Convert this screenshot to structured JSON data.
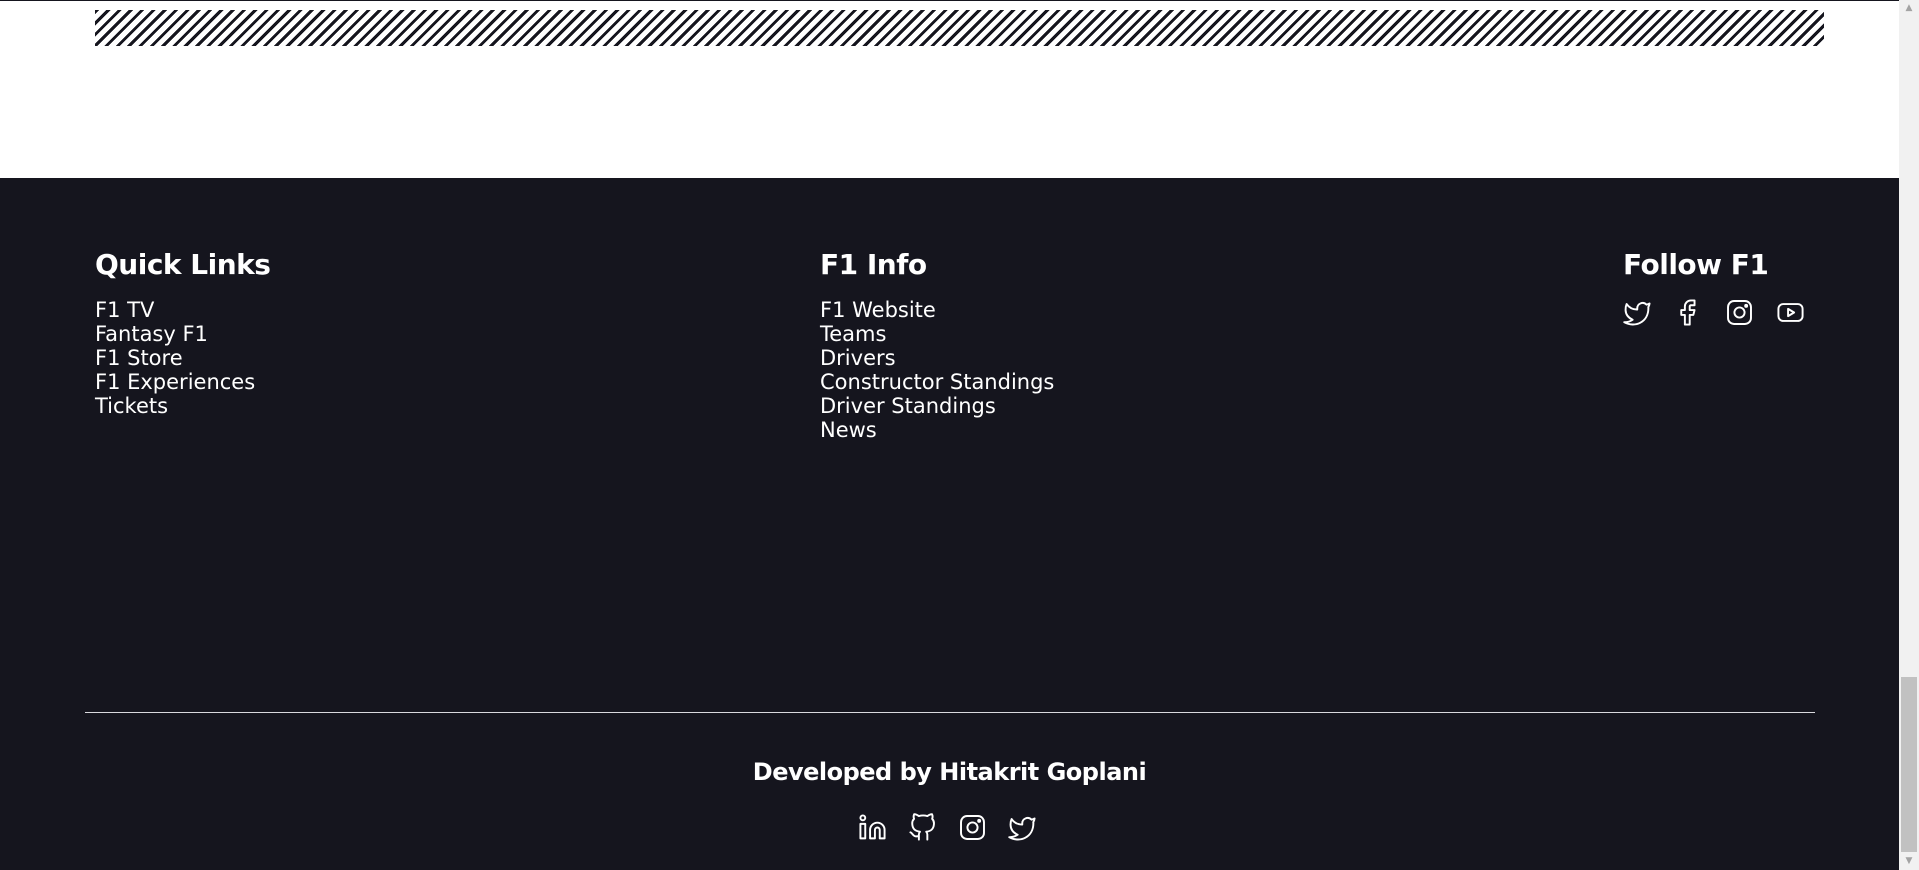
{
  "quick_links": {
    "heading": "Quick Links",
    "items": [
      "F1 TV",
      "Fantasy F1",
      "F1 Store",
      "F1 Experiences",
      "Tickets"
    ]
  },
  "f1_info": {
    "heading": "F1 Info",
    "items": [
      "F1 Website",
      "Teams",
      "Drivers",
      "Constructor Standings",
      "Driver Standings",
      "News"
    ]
  },
  "follow": {
    "heading": "Follow F1",
    "icons": [
      "twitter-icon",
      "facebook-icon",
      "instagram-icon",
      "youtube-icon"
    ]
  },
  "credit": {
    "text": "Developed by Hitakrit Goplani",
    "icons": [
      "linkedin-icon",
      "github-icon",
      "instagram-icon",
      "twitter-icon"
    ]
  },
  "colors": {
    "footer_bg": "#15151e",
    "text": "#ffffff",
    "divider": "#d9d9de"
  }
}
